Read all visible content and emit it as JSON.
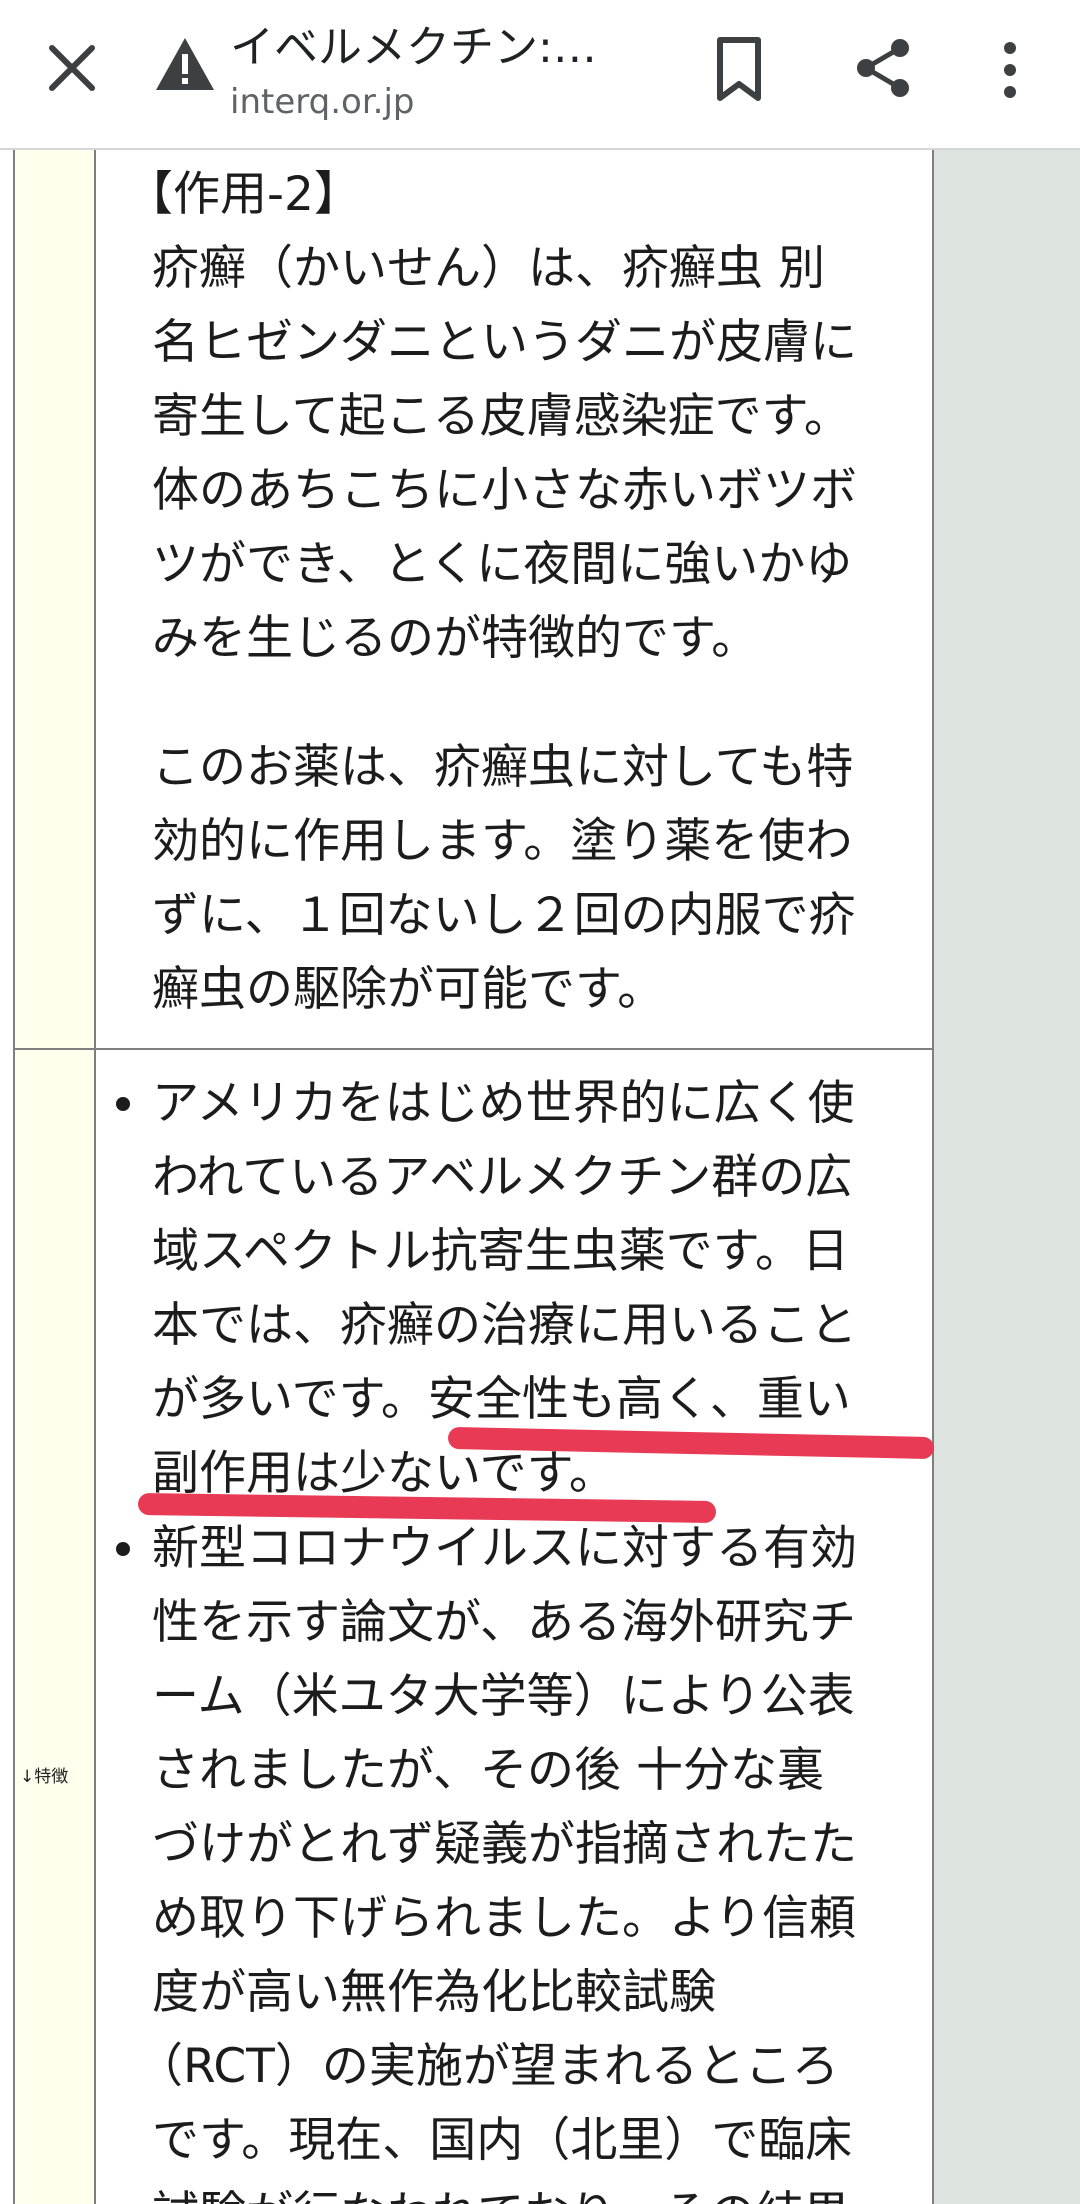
{
  "browser": {
    "title": "イベルメクチン:…",
    "url": "interq.or.jp",
    "icons": {
      "close": "close-icon",
      "warning": "warning-icon",
      "bookmark": "bookmark-icon",
      "share": "share-icon",
      "menu": "more-vert-icon"
    }
  },
  "table": {
    "feature_label": "↓特徴",
    "action_section": {
      "heading": "【作用-2】",
      "para1": [
        "疥癬（かいせん）は、疥癬虫 別",
        "名ヒゼンダニというダニが皮膚に",
        "寄生して起こる皮膚感染症です。",
        "体のあちこちに小さな赤いボツボ",
        "ツができ、とくに夜間に強いかゆ",
        "みを生じるのが特徴的です。"
      ],
      "para2": [
        "このお薬は、疥癬虫に対しても特",
        "効的に作用します。塗り薬を使わ",
        "ずに、１回ないし２回の内服で疥",
        "癬虫の駆除が可能です。"
      ]
    },
    "features": [
      {
        "lines": [
          "アメリカをはじめ世界的に広く使",
          "われているアベルメクチン群の広",
          "域スペクトル抗寄生虫薬です。日",
          "本では、疥癬の治療に用いること",
          "が多いです。安全性も高く、重い",
          "副作用は少ないです。"
        ]
      },
      {
        "lines": [
          "新型コロナウイルスに対する有効",
          "性を示す論文が、ある海外研究チ",
          "ーム（米ユタ大学等）により公表",
          "されましたが、その後 十分な裏",
          "づけがとれず疑義が指摘されたた",
          "め取り下げられました。より信頼",
          "度が高い無作為化比較試験",
          "（RCT）の実施が望まれるところ",
          "です。現在、国内（北里）で臨床",
          "試験が行なわれており、その結果"
        ]
      }
    ]
  },
  "colors": {
    "label_column": "#ffffee",
    "side_panel": "#dde3df",
    "highlight_underline": "#e83a55"
  }
}
